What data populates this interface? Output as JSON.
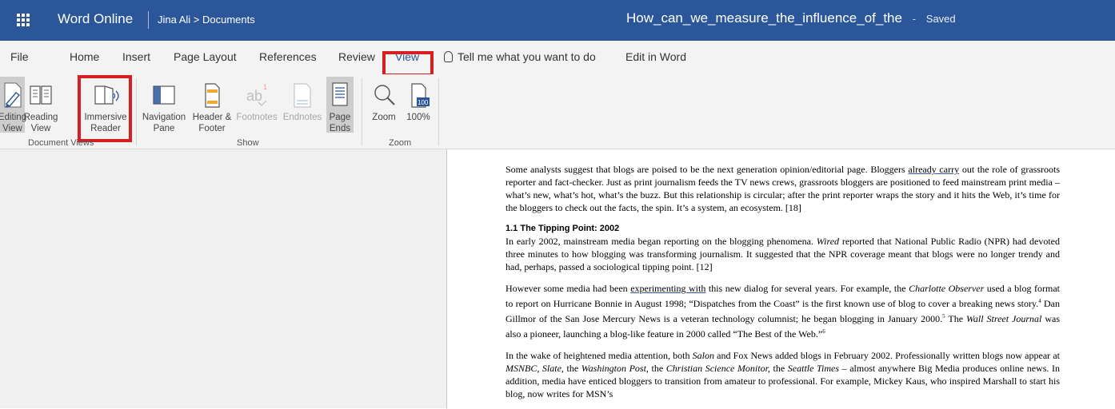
{
  "header": {
    "app_name": "Word Online",
    "breadcrumb": "Jina Ali > Documents",
    "doc_title": "How_can_we_measure_the_influence_of_the",
    "separator": "-",
    "status": "Saved"
  },
  "tabs": [
    "File",
    "Home",
    "Insert",
    "Page Layout",
    "References",
    "Review",
    "View"
  ],
  "active_tab": "View",
  "tell_me": "Tell me what you want to do",
  "edit_in_word": "Edit in Word",
  "ribbon": {
    "groups": {
      "document_views": "Document Views",
      "show": "Show",
      "zoom": "Zoom"
    },
    "buttons": {
      "editing_view": [
        "Editing",
        "View"
      ],
      "reading_view": [
        "Reading",
        "View"
      ],
      "immersive_reader": [
        "Immersive",
        "Reader"
      ],
      "navigation_pane": [
        "Navigation",
        "Pane"
      ],
      "header_footer": [
        "Header &",
        "Footer"
      ],
      "footnotes": "Footnotes",
      "endnotes": "Endnotes",
      "page_ends": [
        "Page",
        "Ends"
      ],
      "zoom": "Zoom",
      "zoom_100": "100%"
    }
  },
  "document": {
    "para1_a": "Some analysts suggest that blogs are poised to be the next generation opinion/editorial page. Bloggers ",
    "para1_squiggle": "already  carry",
    "para1_b": " out the role of grassroots reporter and fact-checker. Just as print journalism feeds the TV news crews, grassroots bloggers are positioned to feed mainstream print media – what’s new, what’s hot, what’s the buzz. But this relationship is circular; after the print reporter wraps the story and it hits the Web, it’s time for the bloggers to check out the facts, the spin. It’s a system, an ecosystem. [18]",
    "heading": "1.1 The Tipping Point: 2002",
    "para2_a": "In early 2002, mainstream media began reporting on the blogging phenomena. ",
    "para2_wired": "Wired",
    "para2_b": " reported that National Public Radio (NPR) had devoted three minutes to how blogging was transforming journalism. It suggested that the NPR coverage meant that blogs were no longer trendy and had, perhaps, passed a sociological tipping point. [12]",
    "para3_a": "However some media had been ",
    "para3_squiggle": "experimenting  with",
    "para3_b": "  this new dialog for several years. For example, the ",
    "para3_charlotte": "Charlotte Observer",
    "para3_c": " used a blog format to report on Hurricane Bonnie in August 1998; “Dispatches from the Coast” is the first known use of blog to cover a breaking news story.",
    "fn4": "4",
    "para3_d": " Dan Gillmor of the San Jose Mercury News is a veteran technology columnist; he began blogging in January 2000.",
    "fn5": "5",
    "para3_e": " The ",
    "para3_wsj": "Wall Street Journal",
    "para3_f": " was also a pioneer, launching a blog-like feature in 2000 called “The Best of the Web.”",
    "fn6": "6",
    "para4_a": "In the wake of heightened media attention, both ",
    "para4_salon": "Salon",
    "para4_b": " and Fox News added blogs in February 2002. Professionally written blogs now appear at ",
    "para4_msnbc": "MSNBC, Slate,",
    "para4_c": " the ",
    "para4_wapo": "Washington Post,",
    "para4_d": " the ",
    "para4_csm": "Christian Science Monitor,",
    "para4_e": " the ",
    "para4_seattle": "Seattle Times",
    "para4_f": " – almost anywhere Big Media produces online news. In addition, media have enticed bloggers to transition from amateur to professional. For example, Mickey Kaus, who inspired Marshall to start his blog, now writes for MSN’s"
  }
}
